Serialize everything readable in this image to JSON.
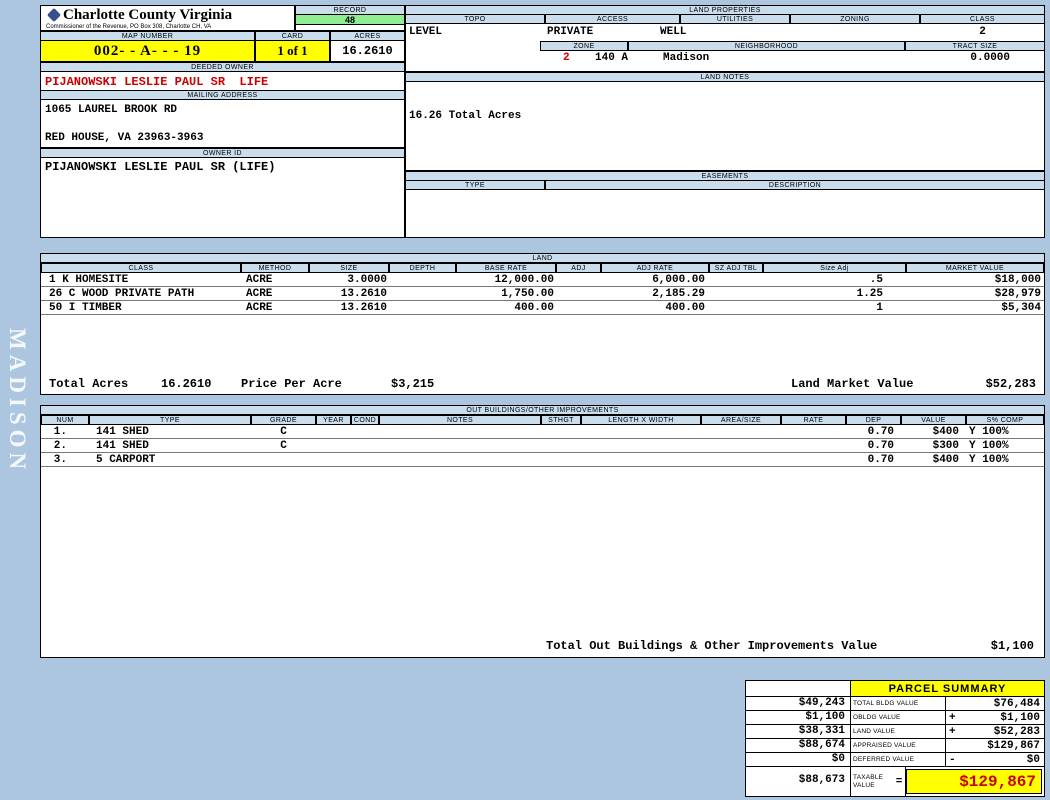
{
  "sidebar": {
    "label": "MADISON"
  },
  "header": {
    "county_title": "Charlotte County Virginia",
    "county_subtitle": "Commissioner of the Revenue, PO Box 308, Charlotte CH, VA",
    "record_label": "RECORD",
    "record_value": "48",
    "map_number_label": "MAP NUMBER",
    "map_number_value": "002- - A- - - 19",
    "card_label": "CARD",
    "card_value": "1 of 1",
    "acres_label": "ACRES",
    "acres_value": "16.2610",
    "deeded_owner_label": "DEEDED OWNER",
    "deeded_owner_value": "PIJANOWSKI LESLIE PAUL SR  LIFE",
    "mailing_address_label": "MAILING ADDRESS",
    "mailing_address_line1": "1065 LAUREL BROOK RD",
    "mailing_address_line2": "RED HOUSE, VA 23963-3963",
    "owner_id_label": "OWNER ID",
    "owner_id_value": "PIJANOWSKI LESLIE PAUL SR (LIFE)"
  },
  "land_properties": {
    "section_label": "LAND PROPERTIES",
    "topo_label": "TOPO",
    "topo_value": "LEVEL",
    "access_label": "ACCESS",
    "access_value": "PRIVATE",
    "utilities_label": "UTILITIES",
    "utilities_value": "WELL",
    "zoning_label": "ZONING",
    "class_label": "CLASS",
    "class_value": "2",
    "zone_label": "ZONE",
    "zone_value": "2",
    "zone_extra": "140 A",
    "neighborhood_label": "NEIGHBORHOOD",
    "neighborhood_value": "Madison",
    "tract_size_label": "TRACT SIZE",
    "tract_size_value": "0.0000",
    "land_notes_label": "LAND NOTES",
    "land_notes_value": "16.26 Total Acres",
    "easements_label": "EASEMENTS",
    "easements_type_label": "TYPE",
    "easements_description_label": "DESCRIPTION"
  },
  "land": {
    "section_label": "LAND",
    "columns": [
      "CLASS",
      "METHOD",
      "SIZE",
      "DEPTH",
      "BASE RATE",
      "ADJ",
      "ADJ RATE",
      "SZ ADJ TBL",
      "Size Adj",
      "MARKET VALUE"
    ],
    "rows": [
      {
        "class": "1 K HOMESITE",
        "method": "ACRE",
        "size": "3.0000",
        "base_rate": "12,000.00",
        "adj_rate": "6,000.00",
        "size_adj": ".5",
        "market_value": "$18,000"
      },
      {
        "class": "26 C WOOD PRIVATE PATH",
        "method": "ACRE",
        "size": "13.2610",
        "base_rate": "1,750.00",
        "adj_rate": "2,185.29",
        "size_adj": "1.25",
        "market_value": "$28,979"
      },
      {
        "class": "50 I TIMBER",
        "method": "ACRE",
        "size": "13.2610",
        "base_rate": "400.00",
        "adj_rate": "400.00",
        "size_adj": "1",
        "market_value": "$5,304"
      }
    ],
    "total_acres_label": "Total Acres",
    "total_acres_value": "16.2610",
    "price_per_acre_label": "Price Per Acre",
    "price_per_acre_value": "$3,215",
    "market_value_label": "Land Market Value",
    "market_value_total": "$52,283"
  },
  "out_buildings": {
    "section_label": "OUT BUILDINGS/OTHER IMPROVEMENTS",
    "columns": [
      "NUM",
      "TYPE",
      "GRADE",
      "YEAR",
      "COND",
      "NOTES",
      "STHGT",
      "LENGTH X WIDTH",
      "AREA/SIZE",
      "RATE",
      "DEP",
      "VALUE",
      "S% COMP"
    ],
    "rows": [
      {
        "num": "1.",
        "type": "141 SHED",
        "grade": "C",
        "dep": "0.70",
        "value": "$400",
        "s_comp": "Y 100%"
      },
      {
        "num": "2.",
        "type": "141 SHED",
        "grade": "C",
        "dep": "0.70",
        "value": "$300",
        "s_comp": "Y 100%"
      },
      {
        "num": "3.",
        "type": "5 CARPORT",
        "dep": "0.70",
        "value": "$400",
        "s_comp": "Y 100%"
      }
    ],
    "total_label": "Total Out Buildings & Other Improvements Value",
    "total_value": "$1,100"
  },
  "parcel_summary": {
    "title": "PARCEL SUMMARY",
    "rows": [
      {
        "prior": "$49,243",
        "label": "TOTAL BLDG VALUE",
        "op": "",
        "current": "$76,484"
      },
      {
        "prior": "$1,100",
        "label": "OBLDG VALUE",
        "op": "+",
        "current": "$1,100"
      },
      {
        "prior": "$38,331",
        "label": "LAND VALUE",
        "op": "+",
        "current": "$52,283"
      },
      {
        "prior": "$88,674",
        "label": "APPRAISED VALUE",
        "op": "",
        "current": "$129,867"
      },
      {
        "prior": "$0",
        "label": "DEFERRED VALUE",
        "op": "-",
        "current": "$0"
      },
      {
        "prior": "$88,673",
        "label": "TAXABLE VALUE",
        "op": "=",
        "current": "$129,867"
      }
    ]
  }
}
